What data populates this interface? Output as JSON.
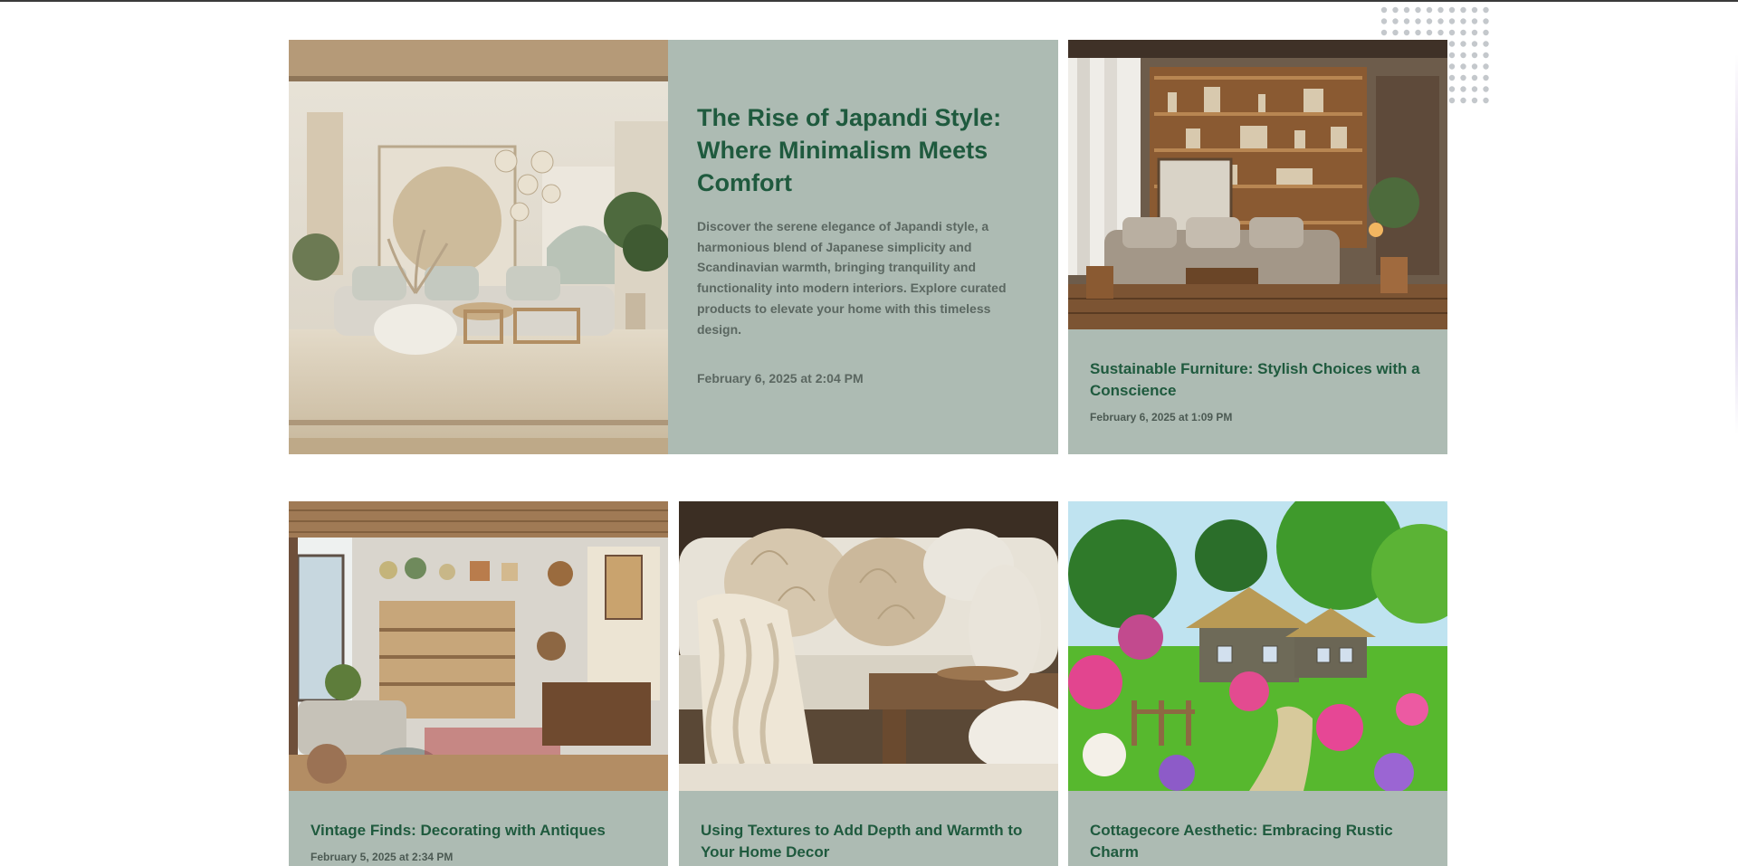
{
  "featured": {
    "title": "The Rise of Japandi Style: Where Minimalism Meets Comfort",
    "excerpt": "Discover the serene elegance of Japandi style, a harmonious blend of Japanese simplicity and Scandinavian warmth, bringing tranquility and functionality into modern interiors. Explore curated products to elevate your home with this timeless design.",
    "date": "February 6, 2025 at 2:04 PM",
    "image_icon": "japandi-living-room-image"
  },
  "posts": [
    {
      "title": "Sustainable Furniture: Stylish Choices with a Conscience",
      "date": "February 6, 2025 at 1:09 PM",
      "image_icon": "wooden-shelf-living-room-image"
    },
    {
      "title": "Vintage Finds: Decorating with Antiques",
      "date": "February 5, 2025 at 2:34 PM",
      "image_icon": "antique-shelves-room-image"
    },
    {
      "title": "Using Textures to Add Depth and Warmth to Your Home Decor",
      "date": "",
      "image_icon": "fur-pillows-knit-throw-image"
    },
    {
      "title": "Cottagecore Aesthetic: Embracing Rustic Charm",
      "date": "",
      "image_icon": "thatched-cottage-garden-image"
    }
  ],
  "colors": {
    "card_background": "#adbbb3",
    "title_green": "#1f5a3e",
    "body_text": "#5b6761"
  }
}
